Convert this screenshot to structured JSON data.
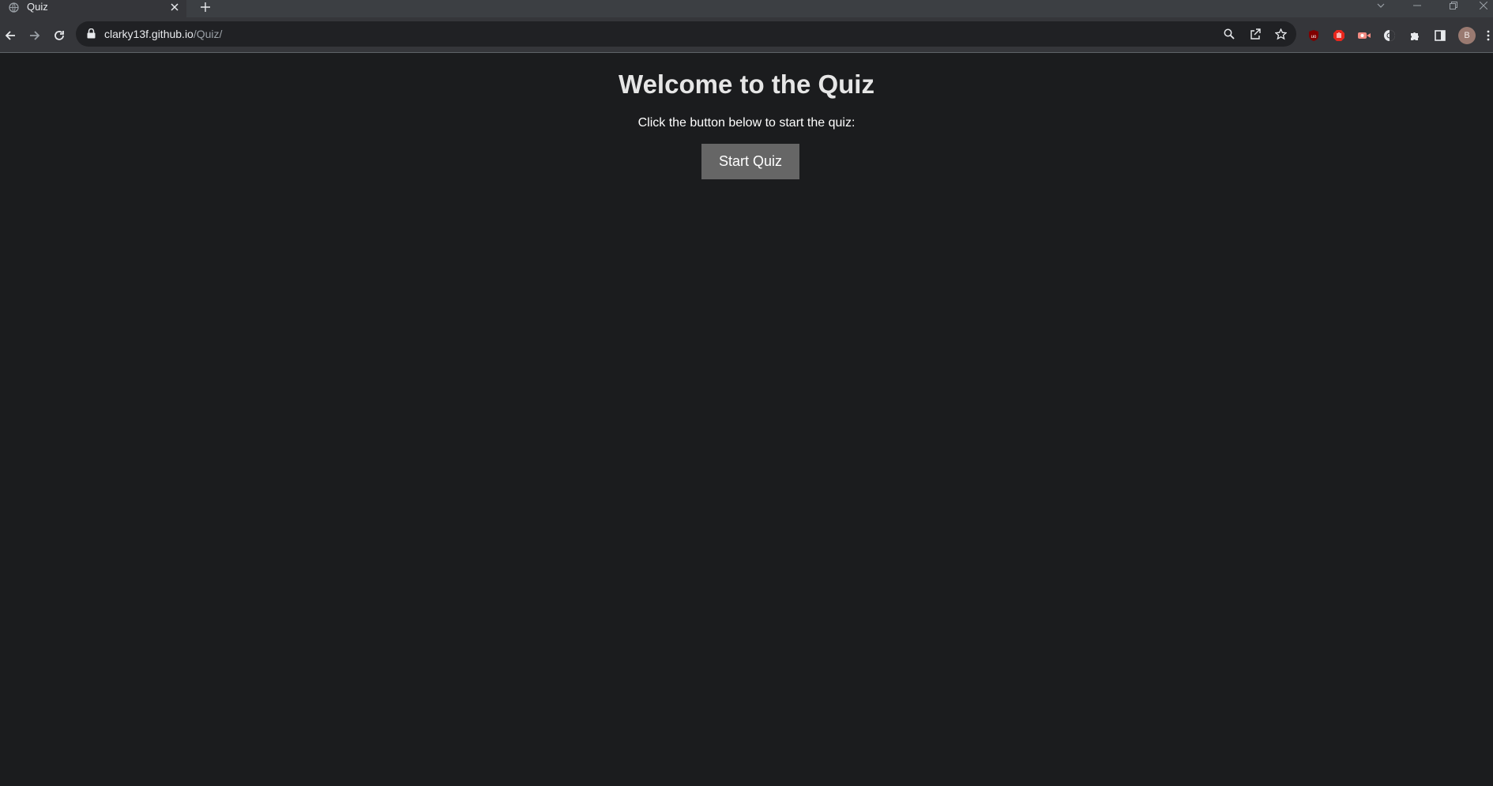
{
  "browser": {
    "tab": {
      "title": "Quiz"
    },
    "address": {
      "host": "clarky13f.github.io",
      "path": "/Quiz/"
    },
    "profile_initial": "B"
  },
  "page": {
    "heading": "Welcome to the Quiz",
    "instruction": "Click the button below to start the quiz:",
    "start_button": "Start Quiz"
  },
  "colors": {
    "page_background": "#1b1c1e",
    "button_background": "#666666",
    "heading_text": "#e6e6e6"
  }
}
